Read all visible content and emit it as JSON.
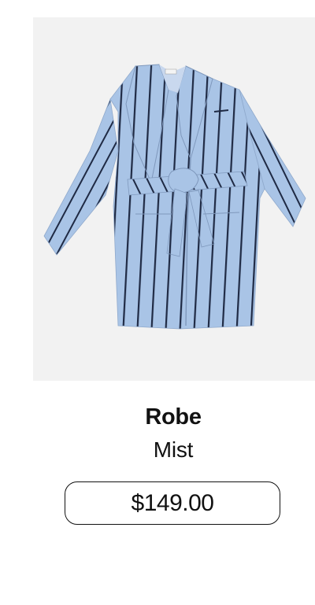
{
  "product": {
    "name": "Robe",
    "variant": "Mist",
    "price": "$149.00",
    "image_icon": "robe-image",
    "colors": {
      "image_background": "#f2f2f2",
      "robe_fabric": "#a9c4e6",
      "stripe": "#1f2a44"
    }
  }
}
